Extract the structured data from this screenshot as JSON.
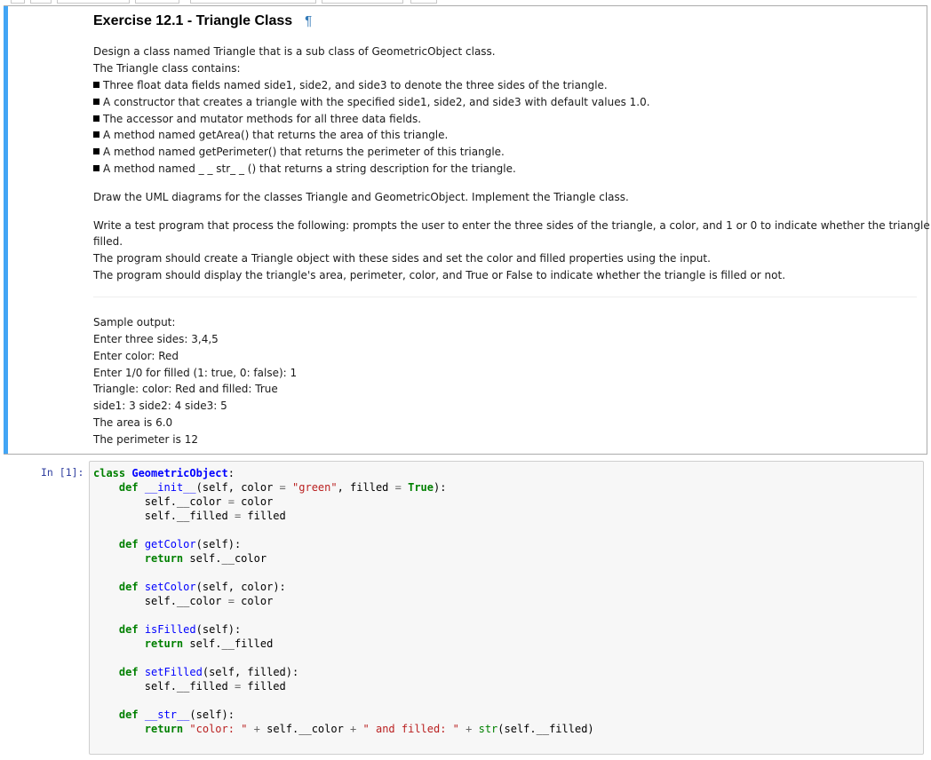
{
  "markdown": {
    "title": "Exercise 12.1 - Triangle Class",
    "pilcrow": "¶",
    "intro1": "Design a class named Triangle that is a sub class of GeometricObject class.",
    "intro2": "The Triangle class contains:",
    "bullets": [
      "Three float data fields named side1, side2, and side3 to denote the three sides of the triangle.",
      "A constructor that creates a triangle with the specified side1, side2, and side3 with default values 1.0.",
      "The accessor and mutator methods for all three data fields.",
      "A method named getArea() that returns the area of this triangle.",
      "A method named getPerimeter() that returns the perimeter of this triangle.",
      "A method named _ _ str_ _ () that returns a string description for the triangle."
    ],
    "uml": "Draw the UML diagrams for the classes Triangle and GeometricObject. Implement the Triangle class.",
    "test1": "Write a test program that process the following: prompts the user to enter the three sides of the triangle, a color, and 1 or 0 to indicate whether the triangle is",
    "test1b": "filled.",
    "test2": "The program should create a Triangle object with these sides and set the color and filled properties using the input.",
    "test3": "The program should display the triangle's area, perimeter, color, and True or False to indicate whether the triangle is filled or not.",
    "sample": [
      "Sample output:",
      "Enter three sides: 3,4,5",
      "Enter color: Red",
      "Enter 1/0 for filled (1: true, 0: false): 1",
      "Triangle: color: Red and filled: True",
      "side1: 3 side2: 4 side3: 5",
      "The area is 6.0",
      "The perimeter is 12"
    ]
  },
  "code_cell": {
    "prompt": "In [1]:",
    "lines": [
      "class GeometricObject:",
      "    def __init__(self, color = \"green\", filled = True):",
      "        self.__color = color",
      "        self.__filled = filled",
      "",
      "    def getColor(self):",
      "        return self.__color",
      "",
      "    def setColor(self, color):",
      "        self.__color = color",
      "",
      "    def isFilled(self):",
      "        return self.__filled",
      "",
      "    def setFilled(self, filled):",
      "        self.__filled = filled",
      "",
      "    def __str__(self):",
      "        return \"color: \" + self.__color + \" and filled: \" + str(self.__filled)"
    ]
  },
  "colors": {
    "cell_accent": "#42a5f5",
    "prompt": "#303f9f",
    "keyword": "#008000",
    "function": "#0000ff",
    "string": "#ba2121"
  }
}
